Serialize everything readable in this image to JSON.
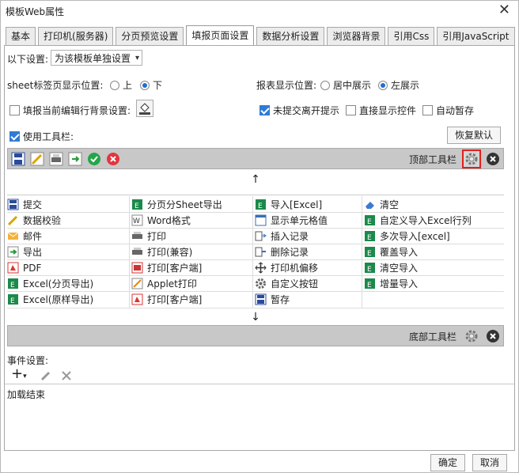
{
  "window": {
    "title": "模板Web属性"
  },
  "tabs": [
    "基本",
    "打印机(服务器)",
    "分页预览设置",
    "填报页面设置",
    "数据分析设置",
    "浏览器背景",
    "引用Css",
    "引用JavaScript"
  ],
  "settings": {
    "scope_label": "以下设置:",
    "scope_value": "为该模板单独设置",
    "sheet_pos_label": "sheet标签页显示位置:",
    "sheet_pos_opt1": "上",
    "sheet_pos_opt2": "下",
    "report_pos_label": "报表显示位置:",
    "report_pos_opt1": "居中展示",
    "report_pos_opt2": "左展示",
    "fill_bg_label": "填报当前编辑行背景设置:",
    "unsubmit_label": "未提交离开提示",
    "direct_ctrl_label": "直接显示控件",
    "autosave_label": "自动暂存",
    "use_toolbar_label": "使用工具栏:",
    "restore_default": "恢复默认"
  },
  "top_toolbar_label": "顶部工具栏",
  "bottom_toolbar_label": "底部工具栏",
  "items": [
    [
      "提交",
      "分页分Sheet导出",
      "导入[Excel]",
      "清空"
    ],
    [
      "数据校验",
      "Word格式",
      "显示单元格值",
      "自定义导入Excel行列"
    ],
    [
      "邮件",
      "打印",
      "插入记录",
      "多次导入[excel]"
    ],
    [
      "导出",
      "打印(兼容)",
      "删除记录",
      "覆盖导入"
    ],
    [
      "PDF",
      "打印[客户端]",
      "打印机偏移",
      "清空导入"
    ],
    [
      "Excel(分页导出)",
      "Applet打印",
      "自定义按钮",
      "增量导入"
    ],
    [
      "Excel(原样导出)",
      "打印[客户端]",
      "暂存",
      ""
    ]
  ],
  "event": {
    "label": "事件设置:",
    "item": "加载结束"
  },
  "footer": {
    "ok": "确定",
    "cancel": "取消"
  },
  "colors": {
    "highlight_border": "#e02020",
    "toolbar_grey": "#c8c8c8",
    "accent": "#2f7bd6"
  }
}
